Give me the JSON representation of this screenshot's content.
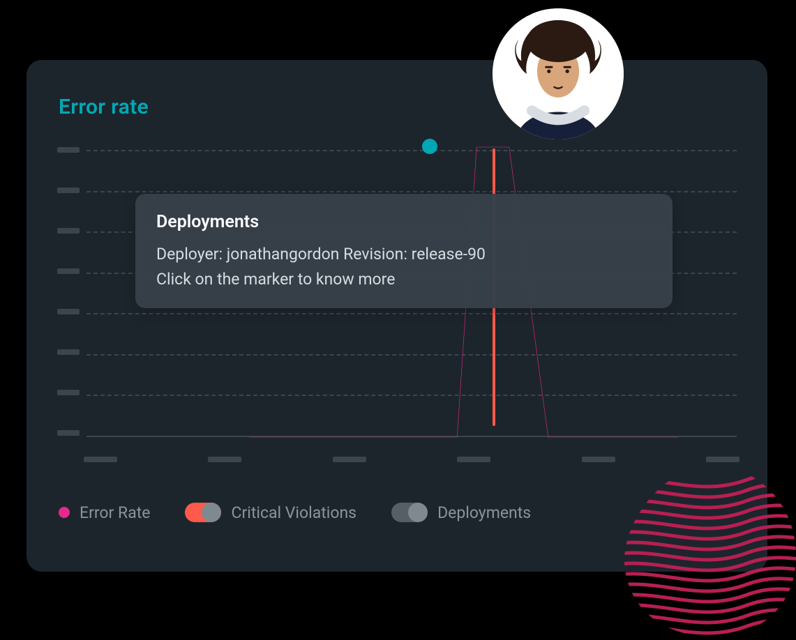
{
  "title": "Error rate",
  "tooltip": {
    "title": "Deployments",
    "detail": "Deployer: jonathangordon  Revision: release-90",
    "hint": "Click on the marker to know more"
  },
  "legend": {
    "error_rate": "Error Rate",
    "critical": "Critical Violations",
    "deployments": "Deployments"
  },
  "colors": {
    "background": "#1d252c",
    "accent": "#00a8b5",
    "error_line": "#e6298b",
    "critical": "#ff5a4a",
    "tick": "#3b454e",
    "text_muted": "#8a949e"
  },
  "chart_data": {
    "type": "line",
    "title": "Error rate",
    "xlabel": "",
    "ylabel": "",
    "x": [
      0,
      1,
      2,
      3,
      4,
      5
    ],
    "series": [
      {
        "name": "Error Rate",
        "color": "#e6298b",
        "points": [
          {
            "x": 1.25,
            "y": 0
          },
          {
            "x": 2.85,
            "y": 0
          },
          {
            "x": 3.0,
            "y": 1.0
          },
          {
            "x": 3.25,
            "y": 1.0
          },
          {
            "x": 3.55,
            "y": 0
          },
          {
            "x": 4.55,
            "y": 0
          }
        ]
      }
    ],
    "markers": {
      "deployment_x": 2.58,
      "critical_violation_x": 3.12
    },
    "ylim": [
      0,
      1
    ],
    "xlim": [
      0,
      5
    ],
    "grid": true,
    "y_tick_count": 8,
    "x_tick_count": 6
  }
}
